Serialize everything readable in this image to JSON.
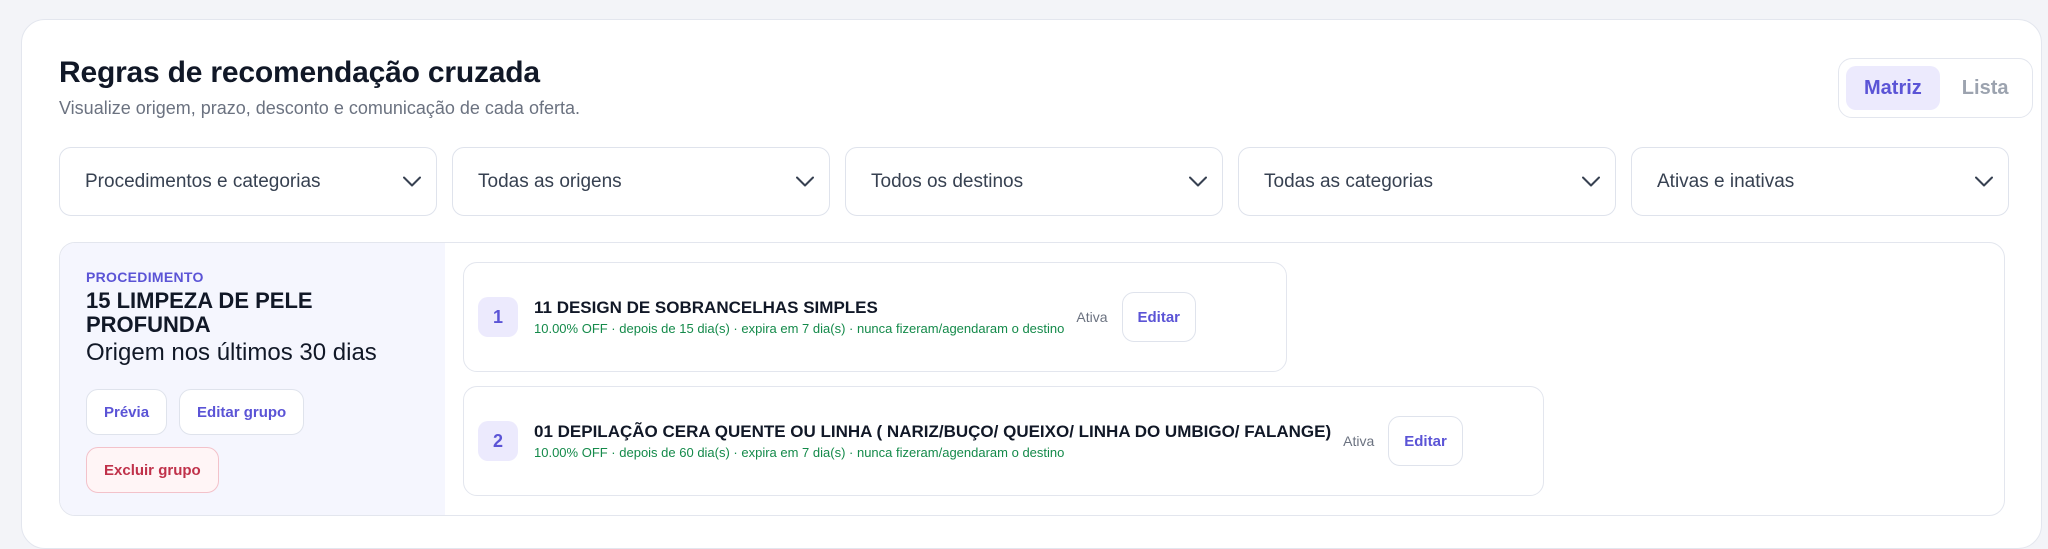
{
  "header": {
    "title": "Regras de recomendação cruzada",
    "subtitle": "Visualize origem, prazo, desconto e comunicação de cada oferta."
  },
  "view_toggle": {
    "matrix_label": "Matriz",
    "list_label": "Lista",
    "selected": "Matriz"
  },
  "filters": [
    {
      "value": "Procedimentos e categorias"
    },
    {
      "value": "Todas as origens"
    },
    {
      "value": "Todos os destinos"
    },
    {
      "value": "Todas as categorias"
    },
    {
      "value": "Ativas e inativas"
    }
  ],
  "group": {
    "kind": "PROCEDIMENTO",
    "name": "15 LIMPEZA DE PELE PROFUNDA",
    "origin": "Origem nos últimos 30 dias",
    "preview_label": "Prévia",
    "edit_group_label": "Editar grupo",
    "delete_group_label": "Excluir grupo",
    "rules": [
      {
        "number": "1",
        "title": "11 DESIGN DE SOBRANCELHAS SIMPLES",
        "meta": "10.00% OFF · depois de 15 dia(s) · expira em 7 dia(s) · nunca fizeram/agendaram o destino",
        "status": "Ativa",
        "edit_label": "Editar"
      },
      {
        "number": "2",
        "title": "01 DEPILAÇÃO CERA QUENTE OU LINHA ( NARIZ/BUÇO/ QUEIXO/ LINHA DO UMBIGO/ FALANGE)",
        "meta": "10.00% OFF · depois de 60 dia(s) · expira em 7 dia(s) · nunca fizeram/agendaram o destino",
        "status": "Ativa",
        "edit_label": "Editar"
      }
    ]
  },
  "colors": {
    "accent": "#5b54d6",
    "success_text": "#148a4a",
    "danger": "#c0314a"
  }
}
